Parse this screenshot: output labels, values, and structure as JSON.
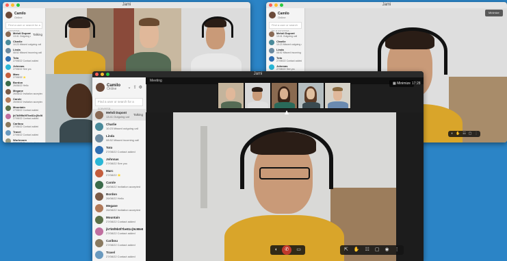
{
  "window_title": "Jami",
  "profile": {
    "name": "Camilo",
    "status": "Online"
  },
  "search_placeholder": "Find a user or search for a conversa...",
  "main_header": {
    "label": "Meeting",
    "time": "17:28",
    "minimize_label": "Minimize"
  },
  "right_header": {
    "minimize_label": "Minimize"
  },
  "conversations": [
    {
      "name": "Mehdi Dupont",
      "sub": "13:41 Outgoing call",
      "status": "Talking",
      "color": "#8a6a55",
      "active": true
    },
    {
      "name": "Charlie",
      "sub": "10:23 Missed outgoing call",
      "color": "#4a8a9a"
    },
    {
      "name": "Linda",
      "sub": "08:52 Missed incoming call",
      "color": "#6c8aa0"
    },
    {
      "name": "Toto",
      "sub": "27/08/22 Contact added",
      "color": "#2f6fb2"
    },
    {
      "name": "Johnnas",
      "sub": "27/08/22 See you",
      "color": "#29b6d6"
    },
    {
      "name": "Marc",
      "sub": "27/08/22 ⭐",
      "color": "#c45d3d"
    },
    {
      "name": "Carole",
      "sub": "26/08/22 Invitation accepted",
      "color": "#3b6b4a"
    },
    {
      "name": "Bordon",
      "sub": "26/08/22 Hello",
      "color": "#7a5b48"
    },
    {
      "name": "Megane",
      "sub": "26/08/22 Invitation accepted",
      "color": "#b07a5a"
    },
    {
      "name": "Mountain",
      "sub": "27/08/22 Contact added",
      "color": "#5a7048"
    },
    {
      "name": "jb7b5f9b0f7be81c{9c98e8a98879}...",
      "sub": "27/08/22 Contact added",
      "color": "#c06fa0"
    },
    {
      "name": "Caribou",
      "sub": "27/08/22 Contact added",
      "color": "#8a7a60"
    },
    {
      "name": "Travel",
      "sub": "27/08/22 Contact added",
      "color": "#6a9abf"
    },
    {
      "name": "Workroom",
      "sub": "27/08/22 Contact added",
      "color": "#9a9a80"
    }
  ],
  "left_mini": [
    {
      "name": "Mehdi Dupont",
      "sub": "13:41 Outgoing call",
      "status": "Talking"
    },
    {
      "name": "Charlie",
      "sub": "10:23 Missed outgoing call"
    },
    {
      "name": "Linda",
      "sub": "08:52 Missed incoming call"
    },
    {
      "name": "Toto",
      "sub": "27/08/22 Contact added"
    },
    {
      "name": "Johnnas",
      "sub": "27/08/22 See you"
    },
    {
      "name": "Marc",
      "sub": "27/08/22 ⭐"
    },
    {
      "name": "Bordon",
      "sub": "26/08/22 Hello"
    },
    {
      "name": "Megane",
      "sub": "26/08/22 Invitation accepted"
    },
    {
      "name": "Carole",
      "sub": "26/08/22 Invitation accepted"
    },
    {
      "name": "Mountain",
      "sub": "27/08/22 Contact added"
    },
    {
      "name": "jb7b5f9b0f7be81c{9c98e8a...",
      "sub": "27/08/22 Contact added"
    },
    {
      "name": "Caribou",
      "sub": "27/08/22 Contact added"
    },
    {
      "name": "Travel",
      "sub": "27/08/22 Contact added"
    },
    {
      "name": "Workroom",
      "sub": "27/08/22 Contact added"
    }
  ],
  "right_mini": [
    {
      "name": "Mehdi Dupont",
      "sub": "13:41 Outgoing call"
    },
    {
      "name": "Charlie",
      "sub": "10:23 Missed outgoing call"
    },
    {
      "name": "Linda",
      "sub": "08:52 Missed incoming call"
    },
    {
      "name": "Toto",
      "sub": "27/08/22 Contact added"
    },
    {
      "name": "Johnnas",
      "sub": "27/08/22 See you"
    },
    {
      "name": "Marc",
      "sub": "27/08/22 ⭐"
    }
  ],
  "icons": {
    "mic": "🎤",
    "hangup": "✆",
    "video": "▭",
    "chat": "▢",
    "more": "⋮"
  },
  "colors": {
    "background": "#2b84c6",
    "hangup": "#c0392b"
  }
}
